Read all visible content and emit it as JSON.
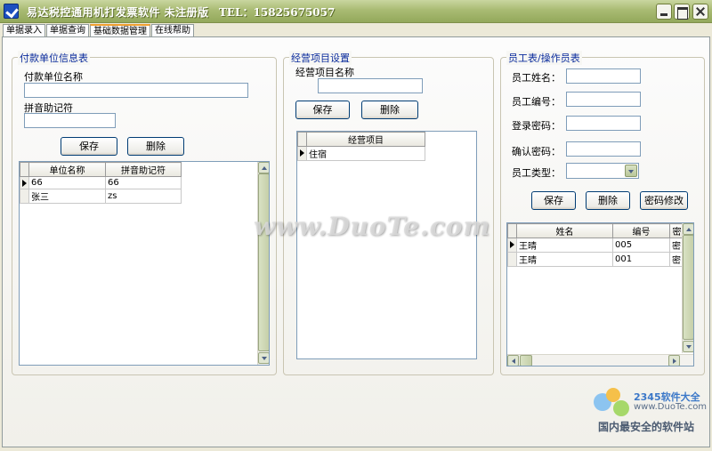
{
  "window": {
    "title": "易达税控通用机打发票软件 未注册版",
    "tel": "TEL：15825675057"
  },
  "tabs": [
    {
      "label": "单据录入"
    },
    {
      "label": "单据查询"
    },
    {
      "label": "基础数据管理"
    },
    {
      "label": "在线帮助"
    }
  ],
  "payer": {
    "group_title": "付款单位信息表",
    "name_label": "付款单位名称",
    "name_value": "",
    "pinyin_label": "拼音助记符",
    "pinyin_value": "",
    "save_label": "保存",
    "delete_label": "删除",
    "columns": [
      "单位名称",
      "拼音助记符"
    ],
    "rows": [
      [
        "66",
        "66"
      ],
      [
        "张三",
        "zs"
      ]
    ]
  },
  "business": {
    "group_title": "经营项目设置",
    "name_label": "经营项目名称",
    "name_value": "",
    "save_label": "保存",
    "delete_label": "删除",
    "columns": [
      "经营项目"
    ],
    "rows": [
      [
        "住宿"
      ]
    ]
  },
  "staff": {
    "group_title": "员工表/操作员表",
    "name_label": "员工姓名：",
    "id_label": "员工编号：",
    "password_label": "登录密码：",
    "confirm_label": "确认密码：",
    "type_label": "员工类型：",
    "type_value": "",
    "save_label": "保存",
    "delete_label": "删除",
    "change_pwd_label": "密码修改",
    "columns": [
      "姓名",
      "编号",
      "密"
    ],
    "rows": [
      [
        "王晴",
        "005",
        "密"
      ],
      [
        "王晴",
        "001",
        "密"
      ]
    ]
  },
  "watermark": {
    "text": "www.DuoTe.com",
    "brand": "2345软件大全",
    "url": "www.DuoTe.com",
    "slogan": "国内最安全的软件站"
  },
  "colors": {
    "titlebar": "#a9bb73",
    "group_title": "#0a2b9c",
    "button_border": "#003c74"
  }
}
